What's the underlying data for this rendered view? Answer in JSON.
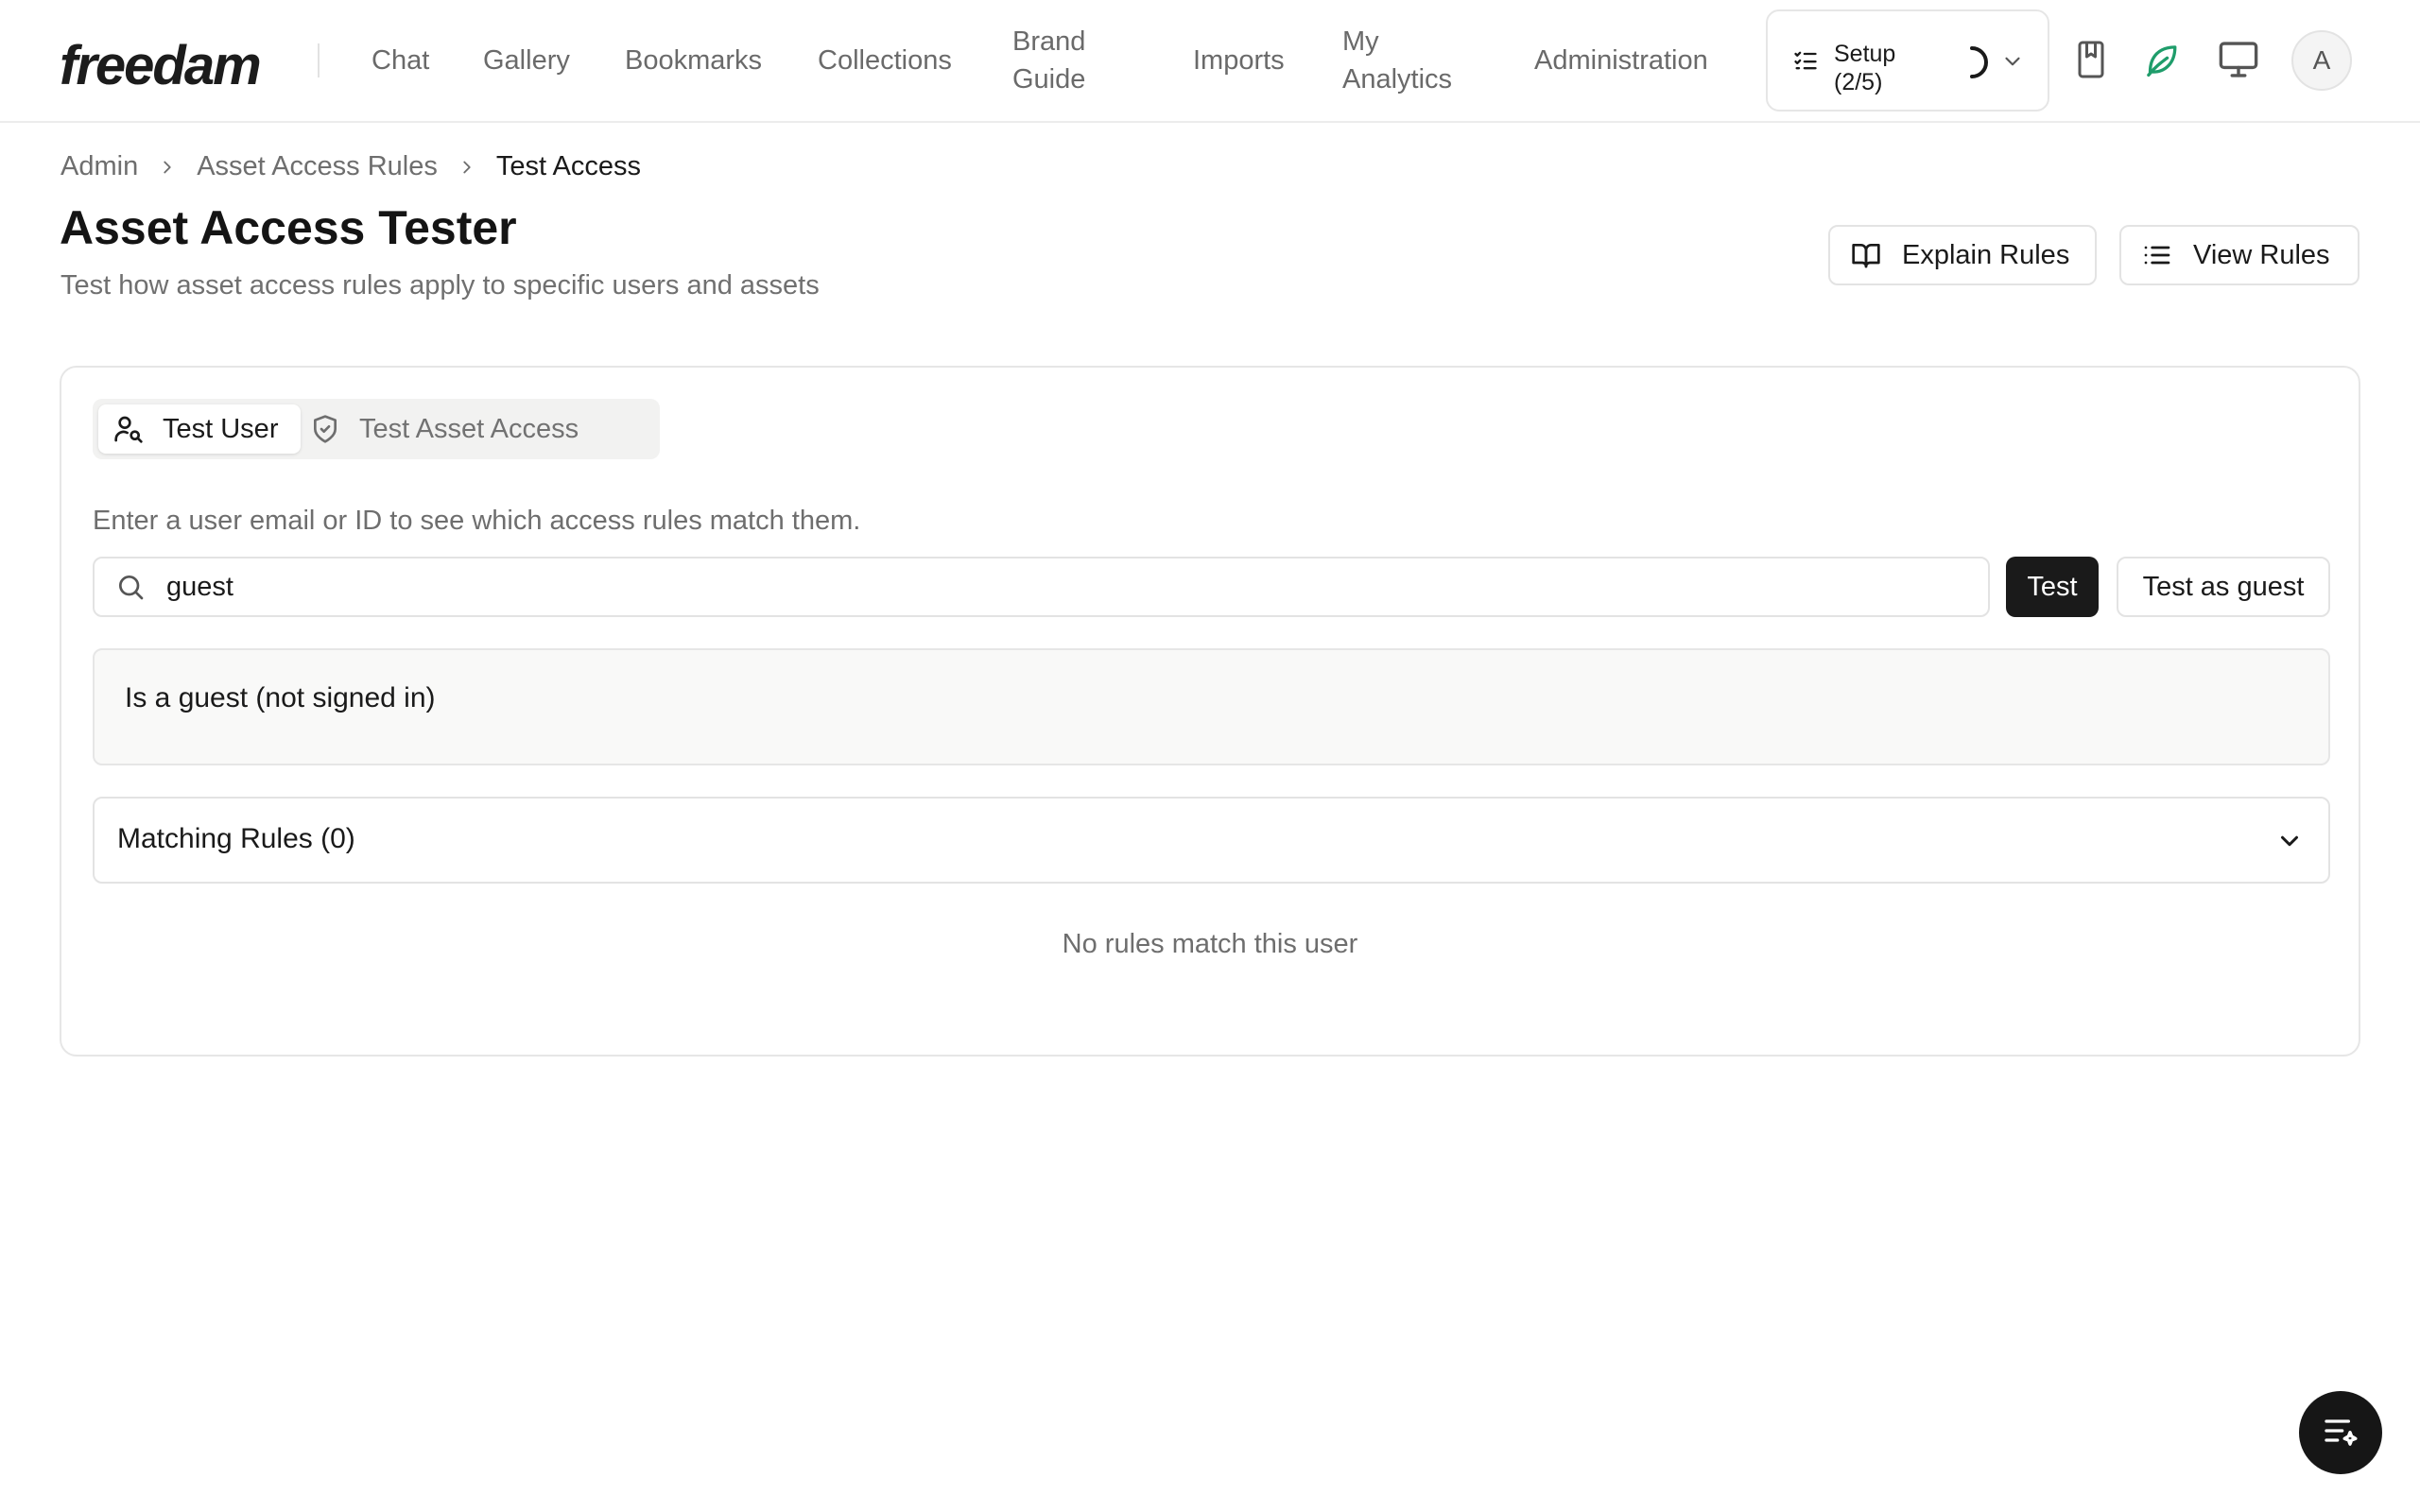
{
  "brand": {
    "logo": "freedam"
  },
  "nav": {
    "items": [
      {
        "label": "Chat"
      },
      {
        "label": "Gallery"
      },
      {
        "label": "Bookmarks"
      },
      {
        "label": "Collections"
      },
      {
        "label": "Brand Guide"
      },
      {
        "label": "Imports"
      },
      {
        "label": "My Analytics"
      },
      {
        "label": "Administration"
      }
    ],
    "setup": {
      "label": "Setup (2/5)"
    },
    "avatar_initial": "A",
    "accent_color": "#1f9d6b"
  },
  "breadcrumb": {
    "items": [
      "Admin",
      "Asset Access Rules"
    ],
    "current": "Test Access"
  },
  "page": {
    "title": "Asset Access Tester",
    "subtitle": "Test how asset access rules apply to specific users and assets",
    "explain_label": "Explain Rules",
    "view_label": "View Rules"
  },
  "tester": {
    "tabs": [
      {
        "label": "Test User",
        "icon": "user-search-icon",
        "active": true
      },
      {
        "label": "Test Asset Access",
        "icon": "shield-check-icon",
        "active": false
      }
    ],
    "hint": "Enter a user email or ID to see which access rules match them.",
    "search_value": "guest",
    "test_label": "Test",
    "guest_label": "Test as guest",
    "status": "Is a guest (not signed in)",
    "matching_rules_title": "Matching Rules (0)",
    "empty_message": "No rules match this user"
  }
}
